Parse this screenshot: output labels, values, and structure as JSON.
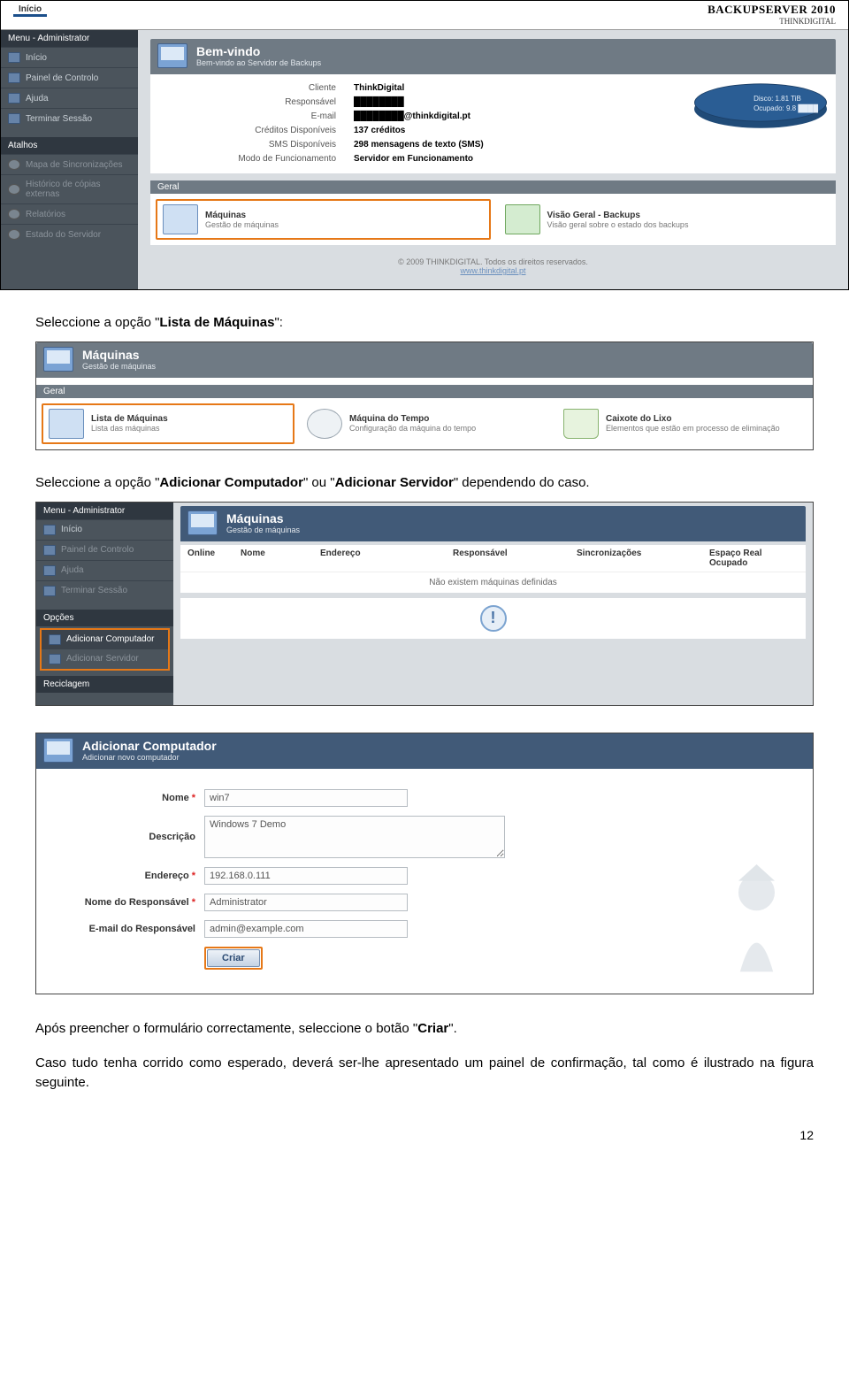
{
  "topbar": {
    "tab": "Início",
    "brand": "BACKUPSERVER 2010",
    "brand_sub": "THINKDIGITAL"
  },
  "sidebar_menu_title": "Menu - Administrator",
  "sidebar_items": [
    "Início",
    "Painel de Controlo",
    "Ajuda",
    "Terminar Sessão"
  ],
  "sidebar_shortcuts_title": "Atalhos",
  "sidebar_shortcuts": [
    "Mapa de Sincronizações",
    "Histórico de cópias externas",
    "Relatórios",
    "Estado do Servidor"
  ],
  "welcome": {
    "title": "Bem-vindo",
    "sub": "Bem-vindo ao Servidor de Backups"
  },
  "info_labels": [
    "Cliente",
    "Responsável",
    "E-mail",
    "Créditos Disponíveis",
    "SMS Disponíveis",
    "Modo de Funcionamento"
  ],
  "info_values": [
    "ThinkDigital",
    "████████",
    "████████@thinkdigital.pt",
    "137 créditos",
    "298 mensagens de texto (SMS)",
    "Servidor em Funcionamento"
  ],
  "disk": {
    "line1": "Disco: 1.81 TiB",
    "line2": "Ocupado: 9.8 ████"
  },
  "section_geral": "Geral",
  "tile_maquinas": {
    "t1": "Máquinas",
    "t2": "Gestão de máquinas"
  },
  "tile_visao": {
    "t1": "Visão Geral - Backups",
    "t2": "Visão geral sobre o estado dos backups"
  },
  "footer": {
    "copy": "© 2009 THINKDIGITAL. Todos os direitos reservados.",
    "link": "www.thinkdigital.pt"
  },
  "para1_a": "Seleccione a opção \"",
  "para1_b": "Lista de Máquinas",
  "para1_c": "\":",
  "shot2_head": {
    "title": "Máquinas",
    "sub": "Gestão de máquinas"
  },
  "shot2_tile1": {
    "t1": "Lista de Máquinas",
    "t2": "Lista das máquinas"
  },
  "shot2_tile2": {
    "t1": "Máquina do Tempo",
    "t2": "Configuração da máquina do tempo"
  },
  "shot2_tile3": {
    "t1": "Caixote do Lixo",
    "t2": "Elementos que estão em processo de eliminação"
  },
  "para2_a": "Seleccione a opção \"",
  "para2_b": "Adicionar Computador",
  "para2_c": "\" ou \"",
  "para2_d": "Adicionar Servidor",
  "para2_e": "\" dependendo do caso.",
  "shot3_head": {
    "title": "Máquinas",
    "sub": "Gestão de máquinas"
  },
  "shot3_cols": [
    "Online",
    "Nome",
    "Endereço",
    "Responsável",
    "Sincronizações",
    "Espaço Real Ocupado"
  ],
  "shot3_empty": "Não existem máquinas definidas",
  "shot3_side_menu_title": "Menu - Administrator",
  "shot3_side_items": [
    "Início",
    "Painel de Controlo",
    "Ajuda",
    "Terminar Sessão"
  ],
  "shot3_side_opcoes": "Opções",
  "shot3_side_opts": [
    "Adicionar Computador",
    "Adicionar Servidor"
  ],
  "shot3_side_recycle": "Reciclagem",
  "shot4_head": {
    "title": "Adicionar Computador",
    "sub": "Adicionar novo computador"
  },
  "form": {
    "nome_label": "Nome",
    "nome_value": "win7",
    "desc_label": "Descrição",
    "desc_value": "Windows 7 Demo",
    "end_label": "Endereço",
    "end_value": "192.168.0.111",
    "resp_label": "Nome do Responsável",
    "resp_value": "Administrator",
    "email_label": "E-mail do Responsável",
    "email_value": "admin@example.com",
    "criar": "Criar"
  },
  "para3_a": "Após preencher o formulário correctamente, seleccione o botão \"",
  "para3_b": "Criar",
  "para3_c": "\".",
  "para4": "Caso tudo tenha corrido como esperado, deverá ser-lhe apresentado um painel de confirmação, tal como é ilustrado na figura seguinte.",
  "pagenum": "12"
}
